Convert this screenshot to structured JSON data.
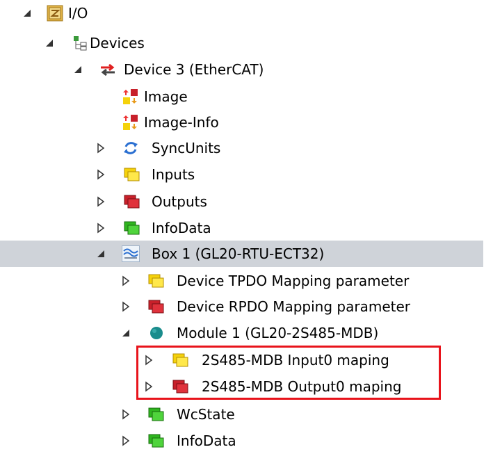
{
  "tree": {
    "io": {
      "label": "I/O",
      "icon": "io-folder-icon",
      "expanded": true
    },
    "devices": {
      "label": "Devices",
      "icon": "devices-icon",
      "expanded": true
    },
    "device3": {
      "label": "Device 3 (EtherCAT)",
      "icon": "ethercat-device-icon",
      "expanded": true
    },
    "image": {
      "label": "Image",
      "icon": "image-icon"
    },
    "image_info": {
      "label": "Image-Info",
      "icon": "image-info-icon"
    },
    "syncunits": {
      "label": "SyncUnits",
      "icon": "syncunits-icon",
      "expanded": false
    },
    "inputs": {
      "label": "Inputs",
      "icon": "inputs-icon",
      "expanded": false
    },
    "outputs": {
      "label": "Outputs",
      "icon": "outputs-icon",
      "expanded": false
    },
    "infodata": {
      "label": "InfoData",
      "icon": "infodata-icon",
      "expanded": false
    },
    "box1": {
      "label": "Box 1 (GL20-RTU-ECT32)",
      "icon": "box-icon",
      "expanded": true,
      "selected": true
    },
    "tpdo": {
      "label": "Device TPDO Mapping parameter",
      "icon": "inputs-icon",
      "expanded": false
    },
    "rpdo": {
      "label": "Device RPDO Mapping parameter",
      "icon": "outputs-icon",
      "expanded": false
    },
    "module1": {
      "label": "Module 1 (GL20-2S485-MDB)",
      "icon": "module-icon",
      "expanded": true
    },
    "input0": {
      "label": "2S485-MDB Input0 maping",
      "icon": "inputs-icon",
      "expanded": false
    },
    "output0": {
      "label": "2S485-MDB Output0 maping",
      "icon": "outputs-icon",
      "expanded": false
    },
    "wcstate": {
      "label": "WcState",
      "icon": "infodata-icon",
      "expanded": false
    },
    "infodata2": {
      "label": "InfoData",
      "icon": "infodata-icon",
      "expanded": false
    }
  },
  "colors": {
    "selection": "#cfd3d9",
    "highlight_border": "#e8131b",
    "inputs_yellow": "#f5d20b",
    "outputs_red": "#c8202a",
    "infodata_green": "#2fb51f",
    "module_teal": "#1a8c8c"
  }
}
